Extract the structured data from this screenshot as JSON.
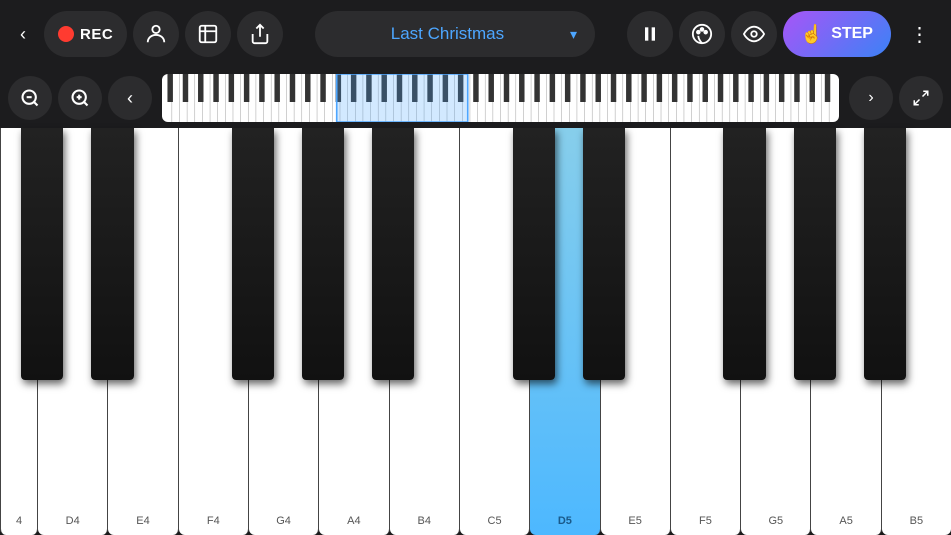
{
  "toolbar": {
    "back_label": "‹",
    "rec_label": "REC",
    "song_title": "Last Christmas",
    "pause_icon": "⏸",
    "palette_icon": "🎨",
    "eye_icon": "👁",
    "step_label": "STEP",
    "more_icon": "•••"
  },
  "mini_keyboard": {
    "zoom_out_icon": "−",
    "zoom_in_icon": "+",
    "left_arrow": "‹",
    "right_arrow": "›",
    "expand_icon": "⤢"
  },
  "piano": {
    "white_keys": [
      {
        "label": "4",
        "id": "C4-left",
        "partial": true
      },
      {
        "label": "D4",
        "highlighted": false
      },
      {
        "label": "E4",
        "highlighted": false
      },
      {
        "label": "F4",
        "highlighted": false
      },
      {
        "label": "G4",
        "highlighted": false
      },
      {
        "label": "A4",
        "highlighted": false
      },
      {
        "label": "B4",
        "highlighted": false
      },
      {
        "label": "C5",
        "highlighted": false
      },
      {
        "label": "D5",
        "highlighted": true
      },
      {
        "label": "E5",
        "highlighted": false
      },
      {
        "label": "F5",
        "highlighted": false
      },
      {
        "label": "G5",
        "highlighted": false
      },
      {
        "label": "A5",
        "highlighted": false
      },
      {
        "label": "B5",
        "highlighted": false
      }
    ],
    "highlight_color": "#4db8ff",
    "highlight_note": "D5"
  },
  "colors": {
    "bg": "#1c1c1e",
    "btn_bg": "#2c2c2e",
    "accent_blue": "#4da6ff",
    "step_gradient_start": "#a855f7",
    "step_gradient_end": "#3b82f6",
    "rec_red": "#ff3b30",
    "key_highlight": "#87CEEB"
  }
}
